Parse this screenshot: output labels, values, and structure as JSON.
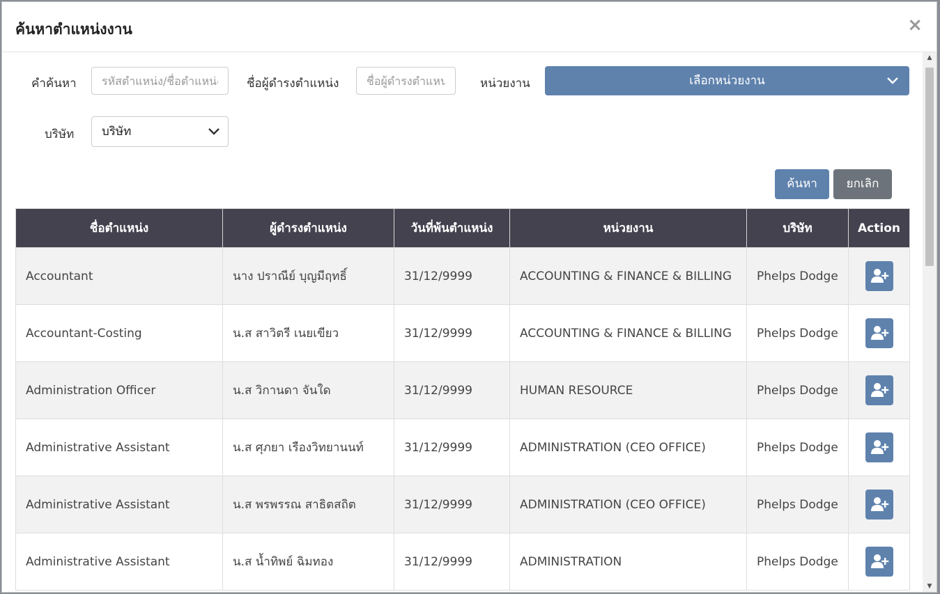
{
  "modal": {
    "title": "ค้นหาตำแหน่งงาน",
    "close": "×"
  },
  "filters": {
    "keyword_label": "คำค้นหา",
    "keyword_placeholder": "รหัสตำแหน่ง/ชื่อตำแหน่ง",
    "holder_label": "ชื่อผู้ดำรงตำแหน่ง",
    "holder_placeholder": "ชื่อผู้ดำรงตำแหน่ง",
    "department_label": "หน่วยงาน",
    "department_value": "เลือกหน่วยงาน",
    "company_label": "บริษัท",
    "company_value": "บริษัท"
  },
  "buttons": {
    "search": "ค้นหา",
    "cancel": "ยกเลิก"
  },
  "colors": {
    "accent": "#5f82ad",
    "header_bg": "#45424f",
    "cancel": "#6c737a"
  },
  "table": {
    "columns": [
      "ชื่อตำแหน่ง",
      "ผู้ดำรงตำแหน่ง",
      "วันที่พ้นตำแหน่ง",
      "หน่วยงาน",
      "บริษัท",
      "Action"
    ],
    "rows": [
      {
        "position": "Accountant",
        "holder": "นาง ปราณีย์ บุญมีฤทธิ์",
        "end_date": "31/12/9999",
        "department": "ACCOUNTING & FINANCE & BILLING",
        "company": "Phelps Dodge"
      },
      {
        "position": "Accountant-Costing",
        "holder": "น.ส สาวิตรี เนยเขียว",
        "end_date": "31/12/9999",
        "department": "ACCOUNTING & FINANCE & BILLING",
        "company": "Phelps Dodge"
      },
      {
        "position": "Administration Officer",
        "holder": "น.ส วิกานดา จันใด",
        "end_date": "31/12/9999",
        "department": "HUMAN RESOURCE",
        "company": "Phelps Dodge"
      },
      {
        "position": "Administrative Assistant",
        "holder": "น.ส ศุภยา เรืองวิทยานนท์",
        "end_date": "31/12/9999",
        "department": "ADMINISTRATION (CEO OFFICE)",
        "company": "Phelps Dodge"
      },
      {
        "position": "Administrative Assistant",
        "holder": "น.ส พรพรรณ สาธิตสถิต",
        "end_date": "31/12/9999",
        "department": "ADMINISTRATION (CEO OFFICE)",
        "company": "Phelps Dodge"
      },
      {
        "position": "Administrative Assistant",
        "holder": "น.ส น้ำทิพย์ ฉิมทอง",
        "end_date": "31/12/9999",
        "department": "ADMINISTRATION",
        "company": "Phelps Dodge"
      }
    ],
    "action_icon": "add-user-icon"
  }
}
